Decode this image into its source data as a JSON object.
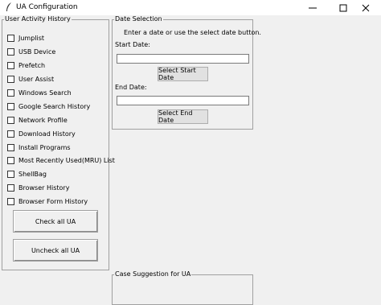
{
  "window": {
    "title": "UA Configuration",
    "controls": {
      "minimize": "minimize",
      "maximize": "maximize",
      "close": "close"
    }
  },
  "user_activity": {
    "legend": "User Activity History",
    "items": [
      {
        "label": "Jumplist",
        "checked": false
      },
      {
        "label": "USB Device",
        "checked": false
      },
      {
        "label": "Prefetch",
        "checked": false
      },
      {
        "label": "User Assist",
        "checked": false
      },
      {
        "label": "Windows Search",
        "checked": false
      },
      {
        "label": "Google Search History",
        "checked": false
      },
      {
        "label": "Network Profile",
        "checked": false
      },
      {
        "label": "Download History",
        "checked": false
      },
      {
        "label": "Install Programs",
        "checked": false
      },
      {
        "label": "Most Recently Used(MRU) List",
        "checked": false
      },
      {
        "label": "ShellBag",
        "checked": false
      },
      {
        "label": "Browser History",
        "checked": false
      },
      {
        "label": "Browser Form History",
        "checked": false
      }
    ],
    "check_all_label": "Check all UA",
    "uncheck_all_label": "Uncheck all UA"
  },
  "date_selection": {
    "legend": "Date Selection",
    "instruction": "Enter a date or use the select date button.",
    "start_label": "Start Date:",
    "start_value": "",
    "select_start_label": "Select Start Date",
    "end_label": "End Date:",
    "end_value": "",
    "select_end_label": "Select End Date"
  },
  "case_suggestion": {
    "legend": "Case Suggestion for UA"
  }
}
